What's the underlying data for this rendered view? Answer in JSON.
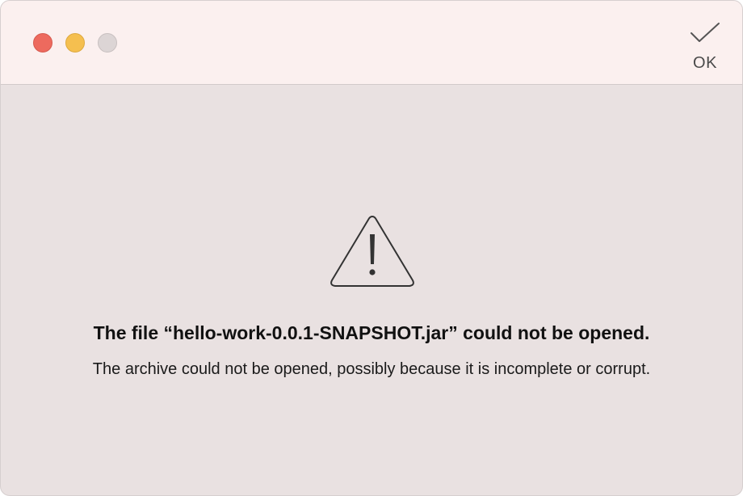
{
  "toolbar": {
    "ok_label": "OK",
    "ok_icon": "checkmark-icon"
  },
  "window_controls": {
    "close_color": "#ed6a5e",
    "minimize_color": "#f5bf4f",
    "zoom_color": "#dcd5d5"
  },
  "alert": {
    "icon": "warning-icon",
    "title": "The file “hello-work-0.0.1-SNAPSHOT.jar” could not be opened.",
    "message": "The archive could not be opened, possibly because it is incomplete or corrupt."
  }
}
